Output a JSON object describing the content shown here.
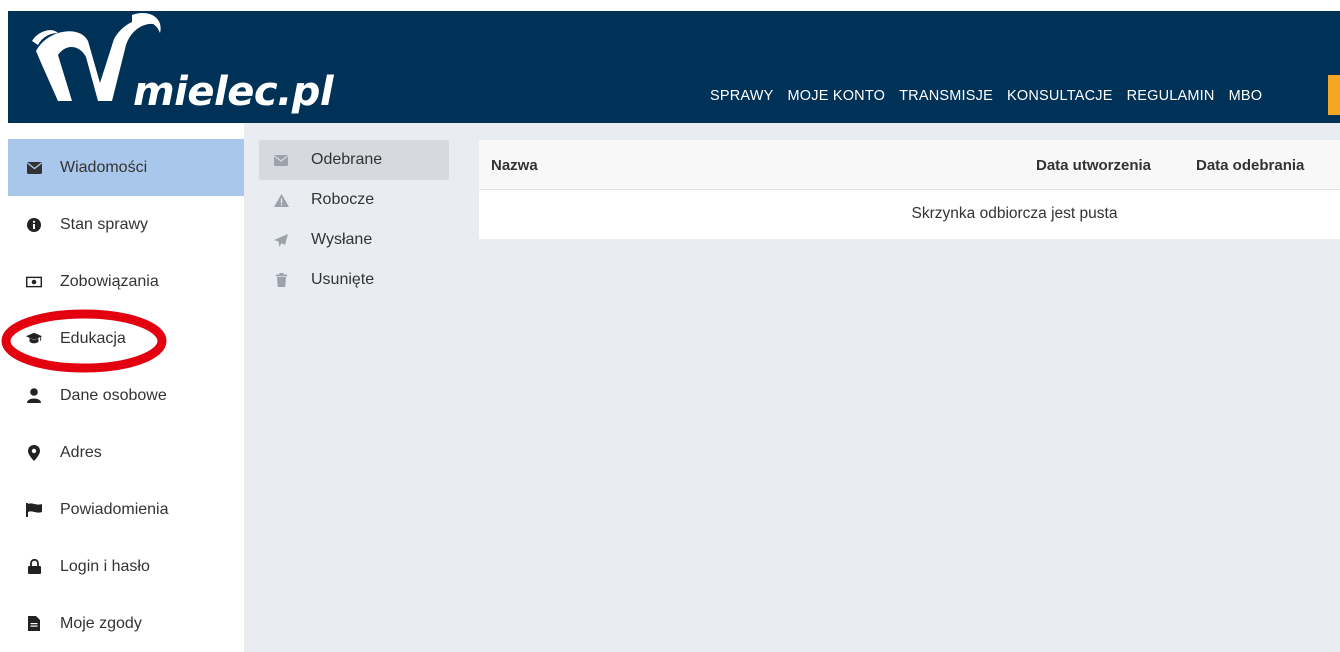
{
  "header": {
    "logo_text": "mielec.pl",
    "nav": [
      "SPRAWY",
      "MOJE KONTO",
      "TRANSMISJE",
      "KONSULTACJE",
      "REGULAMIN",
      "MBO"
    ]
  },
  "sidebar": {
    "items": [
      {
        "label": "Wiadomości",
        "icon": "envelope-icon",
        "active": true
      },
      {
        "label": "Stan sprawy",
        "icon": "info-circle-icon"
      },
      {
        "label": "Zobowiązania",
        "icon": "money-bill-icon"
      },
      {
        "label": "Edukacja",
        "icon": "graduation-cap-icon"
      },
      {
        "label": "Dane osobowe",
        "icon": "user-icon"
      },
      {
        "label": "Adres",
        "icon": "map-marker-icon"
      },
      {
        "label": "Powiadomienia",
        "icon": "flag-icon"
      },
      {
        "label": "Login i hasło",
        "icon": "lock-icon"
      },
      {
        "label": "Moje zgody",
        "icon": "file-icon"
      }
    ]
  },
  "folders": {
    "items": [
      {
        "label": "Odebrane",
        "icon": "envelope-icon",
        "active": true
      },
      {
        "label": "Robocze",
        "icon": "warning-icon"
      },
      {
        "label": "Wysłane",
        "icon": "paper-plane-icon"
      },
      {
        "label": "Usunięte",
        "icon": "trash-icon"
      }
    ]
  },
  "table": {
    "columns": [
      "Nazwa",
      "Data utworzenia",
      "Data odebrania"
    ],
    "empty_message": "Skrzynka odbiorcza jest pusta"
  },
  "colors": {
    "header_bg": "#003257",
    "active_item_bg": "#a9c7ea",
    "content_bg": "#e9ecf0",
    "accent_orange": "#f5a623",
    "annotation_red": "#e3000f"
  }
}
